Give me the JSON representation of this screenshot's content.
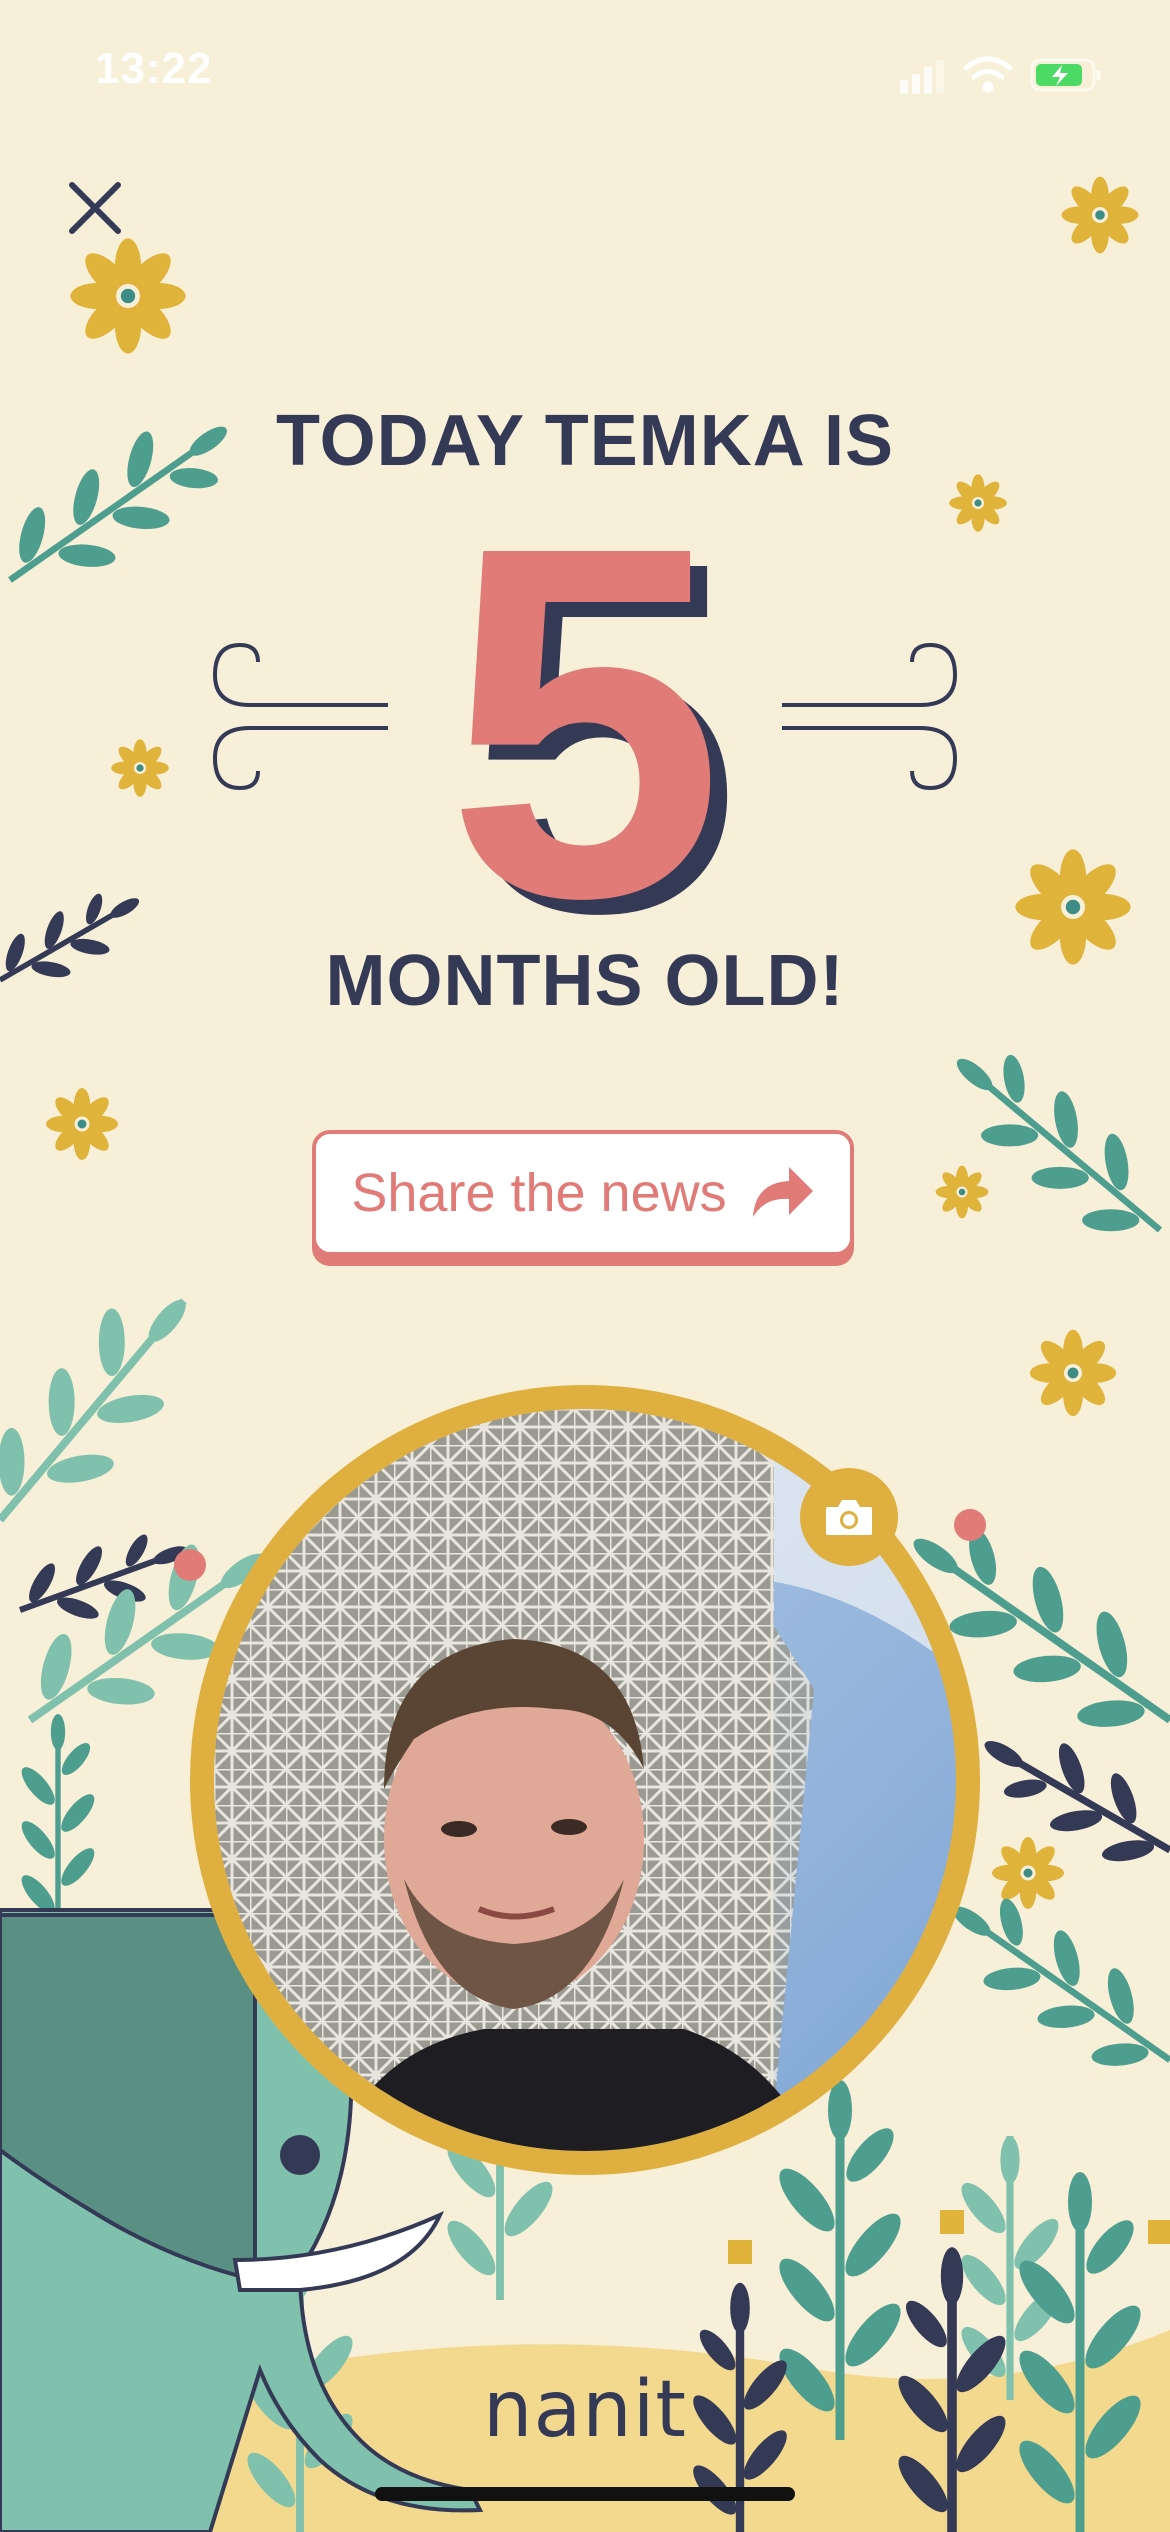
{
  "status_bar": {
    "time": "13:22"
  },
  "milestone": {
    "headline_top": "TODAY TEMKA IS",
    "age_number": "5",
    "headline_bottom": "MONTHS OLD!"
  },
  "share": {
    "label": "Share the news",
    "icon": "share-arrow-icon"
  },
  "photo": {
    "frame_icon": "camera-icon"
  },
  "brand": {
    "name": "nanit"
  },
  "colors": {
    "background": "#F7EFD7",
    "text_dark": "#343A56",
    "accent_coral": "#E07B77",
    "frame_gold": "#DFB03F",
    "leaf_teal": "#4E9E8F",
    "elephant": "#7FC1AD"
  }
}
